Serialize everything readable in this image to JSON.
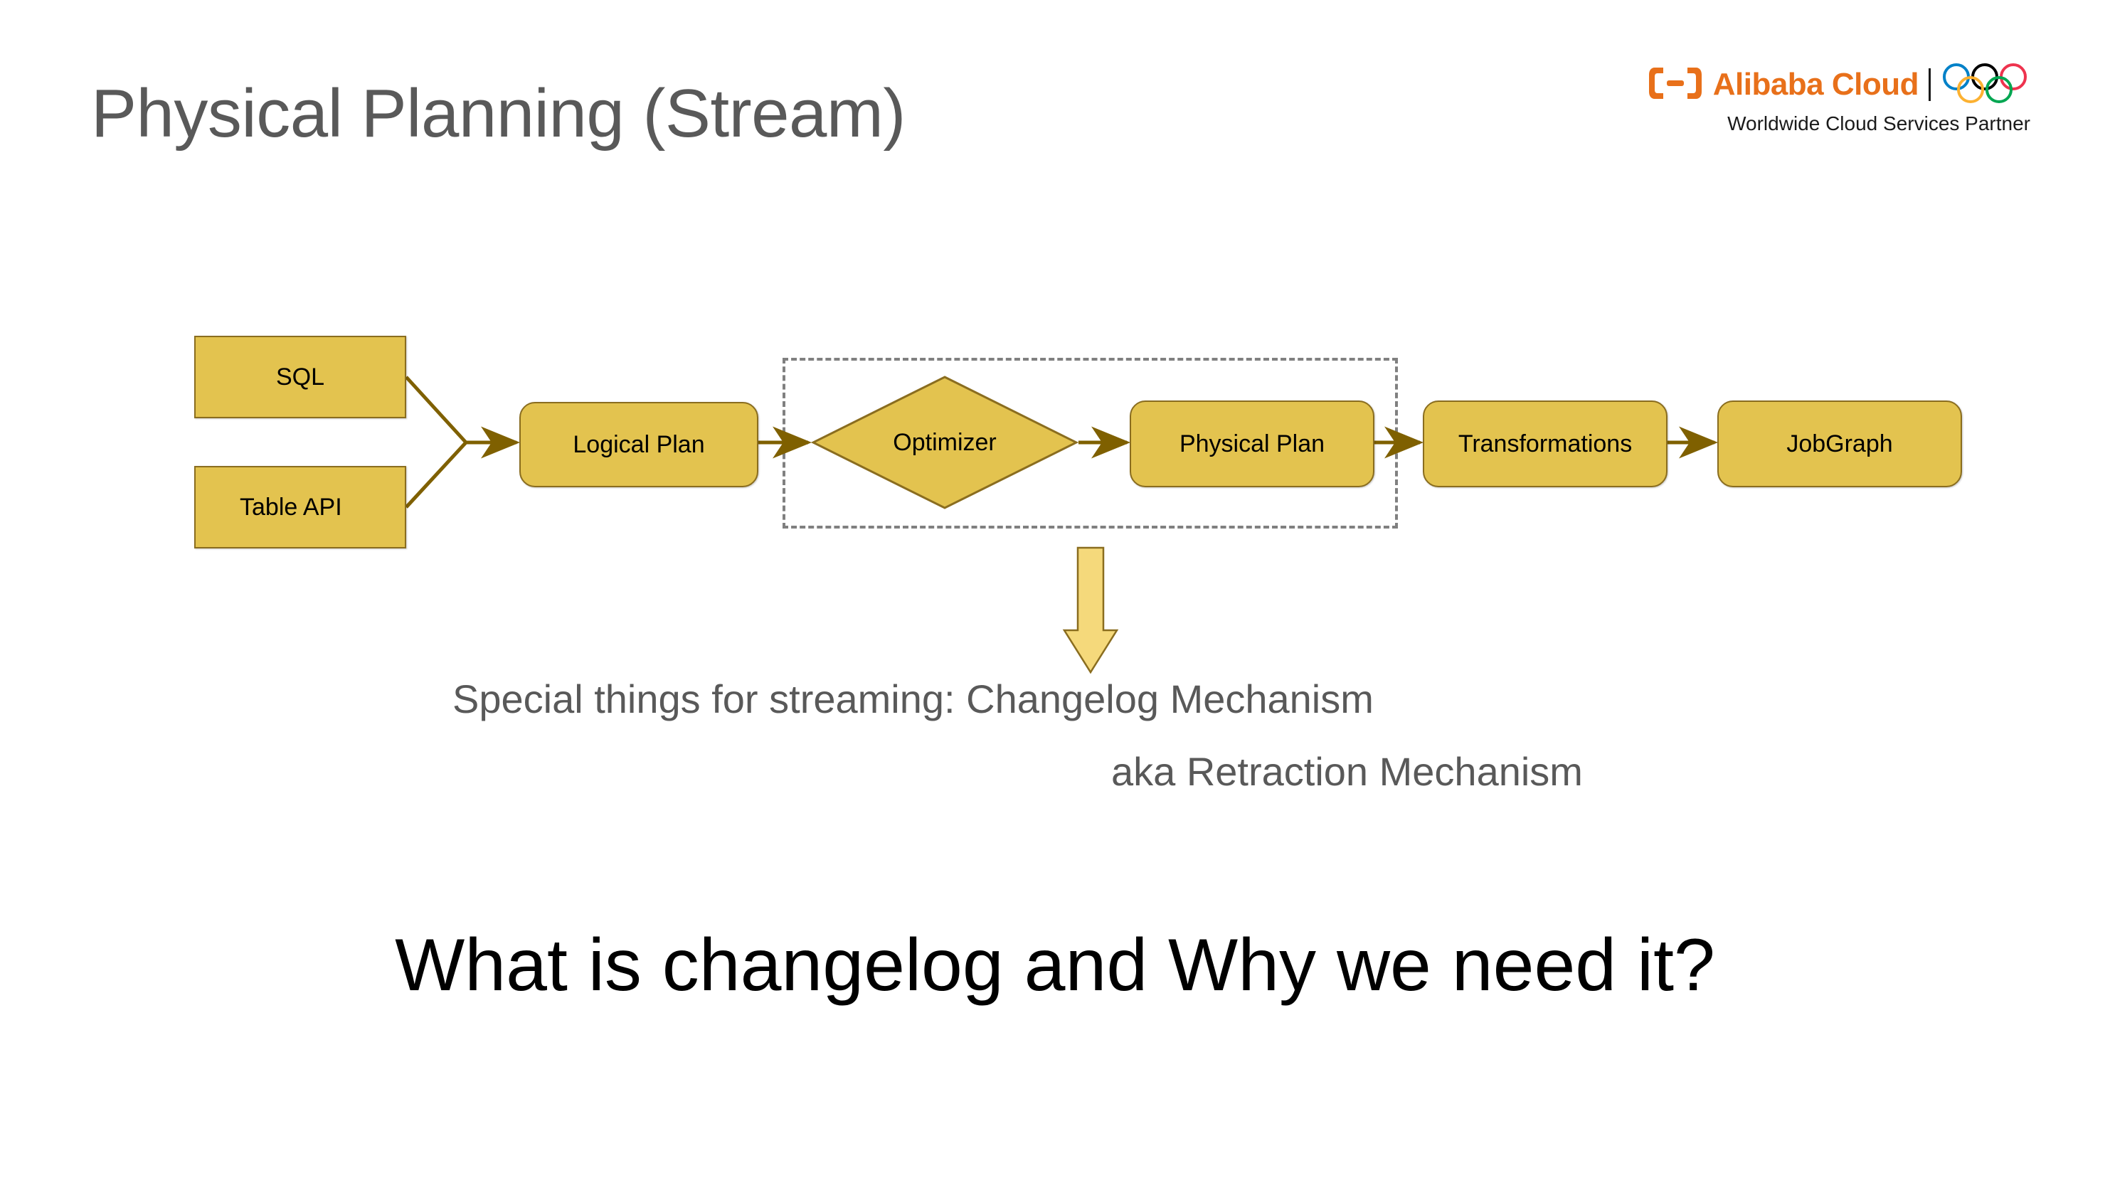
{
  "slide": {
    "title": "Physical Planning (Stream)",
    "title_color": "#595959",
    "background": "#ffffff"
  },
  "brand": {
    "wordmark": "Alibaba Cloud",
    "tagline": "Worldwide Cloud Services Partner",
    "mark_icon": "alibaba-cloud-bracket-icon",
    "rings_icon": "olympic-rings-icon",
    "brand_color": "#E8701A",
    "ring_colors": [
      "#0081C8",
      "#000000",
      "#EE334E",
      "#FCB131",
      "#00A651"
    ]
  },
  "diagram": {
    "node_fill": "#E3C34F",
    "node_stroke": "#8a6d1f",
    "connector_color": "#7F6000",
    "group_border_color": "#808080",
    "arrow_fill": "#F5D97B",
    "arrow_stroke": "#8a6d1f",
    "nodes": [
      {
        "id": "sql",
        "label": "SQL",
        "shape": "rectangle"
      },
      {
        "id": "table-api",
        "label": "Table API",
        "shape": "rectangle"
      },
      {
        "id": "logical-plan",
        "label": "Logical Plan",
        "shape": "rounded-rectangle"
      },
      {
        "id": "optimizer",
        "label": "Optimizer",
        "shape": "diamond"
      },
      {
        "id": "physical-plan",
        "label": "Physical Plan",
        "shape": "rounded-rectangle"
      },
      {
        "id": "transformations",
        "label": "Transformations",
        "shape": "rounded-rectangle"
      },
      {
        "id": "jobgraph",
        "label": "JobGraph",
        "shape": "rounded-rectangle"
      }
    ],
    "edges": [
      {
        "from": "sql",
        "to": "logical-plan"
      },
      {
        "from": "table-api",
        "to": "logical-plan"
      },
      {
        "from": "logical-plan",
        "to": "optimizer"
      },
      {
        "from": "optimizer",
        "to": "physical-plan"
      },
      {
        "from": "physical-plan",
        "to": "transformations"
      },
      {
        "from": "transformations",
        "to": "jobgraph"
      }
    ],
    "group_box": {
      "contains": [
        "optimizer",
        "physical-plan"
      ],
      "style": "dashed"
    },
    "callout_arrow": {
      "direction": "down",
      "from": "optimizer-group-box",
      "to": "caption"
    }
  },
  "caption": {
    "line1": "Special things for streaming: Changelog Mechanism",
    "line2": "aka Retraction Mechanism",
    "color": "#595959"
  },
  "headline": {
    "text": "What is changelog and Why we need it?",
    "color": "#000000"
  }
}
